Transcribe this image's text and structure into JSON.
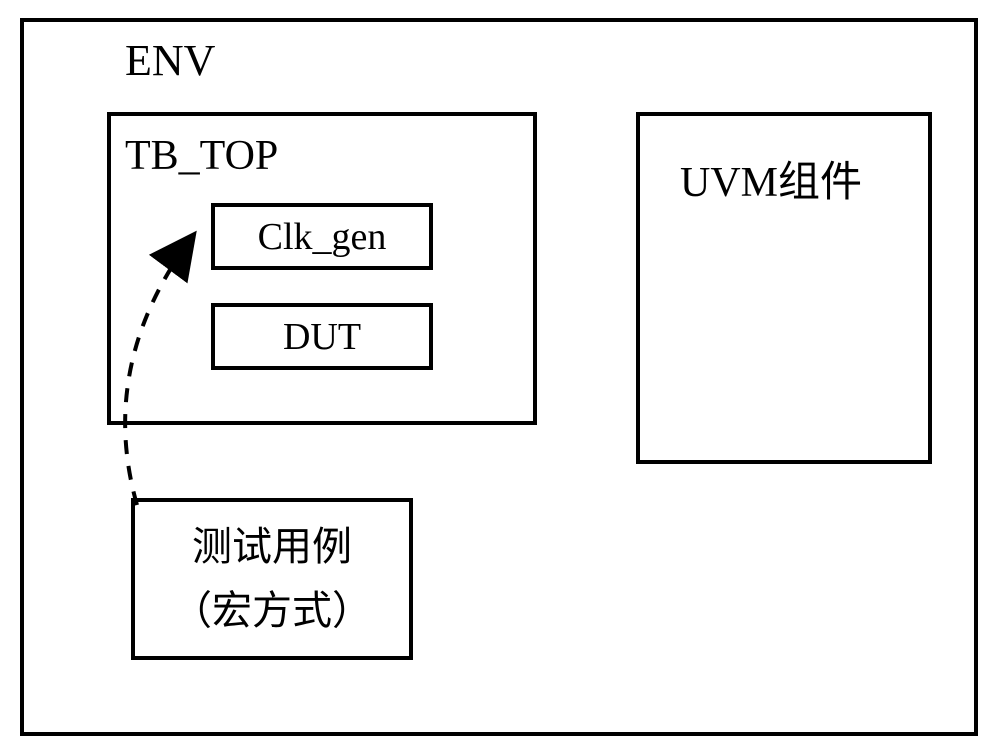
{
  "env": {
    "label": "ENV"
  },
  "tb_top": {
    "label": "TB_TOP",
    "clk_gen": "Clk_gen",
    "dut": "DUT"
  },
  "uvm": {
    "label": "UVM组件"
  },
  "testcase": {
    "line1": "测试用例",
    "line2": "（宏方式）"
  }
}
